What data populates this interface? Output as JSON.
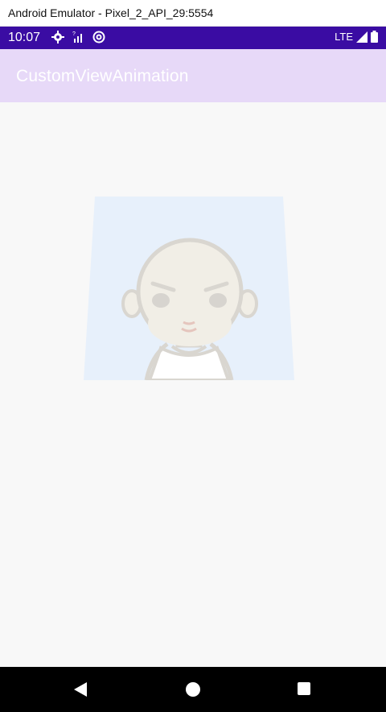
{
  "window": {
    "title": "Android Emulator - Pixel_2_API_29:5554"
  },
  "status_bar": {
    "time": "10:07",
    "icons": [
      "gear-icon",
      "signal-cross-icon",
      "sync-icon"
    ],
    "network": "LTE",
    "right_icons": [
      "signal-icon",
      "battery-icon"
    ]
  },
  "app_bar": {
    "title": "CustomViewAnimation"
  },
  "content": {
    "image": {
      "name": "animated-character-image",
      "background": "#e7f0fb",
      "skin": "#f1eee6",
      "outline": "#d9d6d0"
    }
  },
  "nav_bar": {
    "buttons": [
      "back-icon",
      "home-icon",
      "recents-icon"
    ]
  }
}
